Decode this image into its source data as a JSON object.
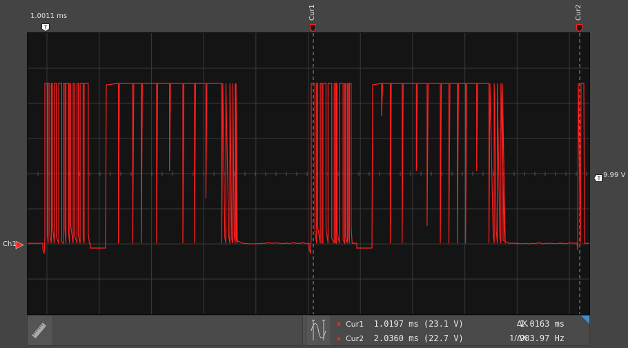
{
  "trigger": {
    "time_label": "1.0011 ms",
    "marker": "T",
    "level_label": "9.99 V"
  },
  "channel": {
    "label": "Ch1",
    "color": "#ff2020"
  },
  "cursors": [
    {
      "label": "Cur1",
      "time": "1.0197 ms",
      "value": "(23.1 V)"
    },
    {
      "label": "Cur2",
      "time": "2.0360 ms",
      "value": "(22.7 V)"
    }
  ],
  "measurements": {
    "delta_x_label": "ΔX",
    "delta_x": "1.0163 ms",
    "inv_delta_x_label": "1/ΔX",
    "inv_delta_x": "983.97 Hz"
  },
  "icons": {
    "ruler": "ruler-icon",
    "cursor_measure": "cursor-measure-icon"
  },
  "colors": {
    "trace": "#ff2020",
    "background": "#141414",
    "grid": "#3a3a3a",
    "corner_accent": "#3f8fd0"
  }
}
